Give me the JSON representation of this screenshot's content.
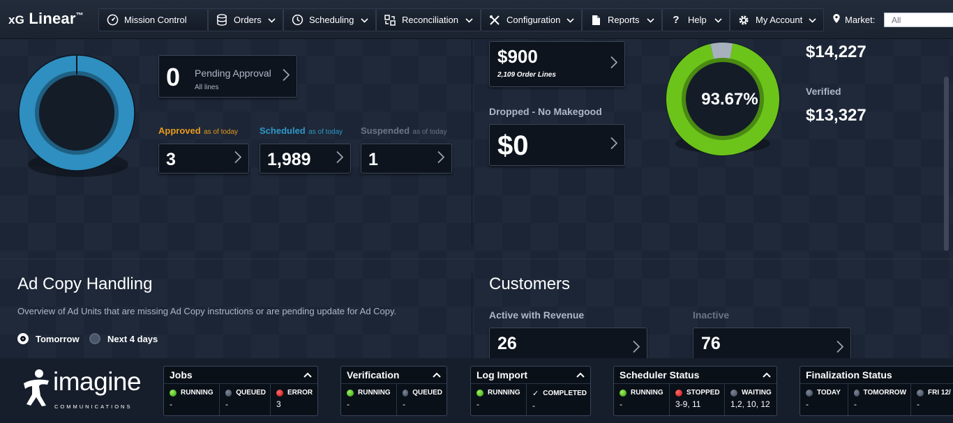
{
  "brand": {
    "prefix": "xG",
    "name": "Linear",
    "tm": "™"
  },
  "nav": [
    {
      "label": "Mission Control",
      "icon": "dashboard-icon"
    },
    {
      "label": "Orders",
      "icon": "database-icon"
    },
    {
      "label": "Scheduling",
      "icon": "clock-icon"
    },
    {
      "label": "Reconciliation",
      "icon": "reconcile-icon"
    },
    {
      "label": "Configuration",
      "icon": "tools-icon"
    },
    {
      "label": "Reports",
      "icon": "document-icon"
    },
    {
      "label": "Help",
      "icon": "question-icon"
    },
    {
      "label": "My Account",
      "icon": "gear-icon"
    }
  ],
  "market": {
    "label": "Market:",
    "value": "All"
  },
  "orders_panel": {
    "donut_colors": {
      "ring": "#2e8fc0",
      "inner": "#1f5f82"
    },
    "pending": {
      "value": "0",
      "label": "Pending Approval",
      "sub": "All lines"
    },
    "approved": {
      "label": "Approved",
      "asof": "as of today",
      "value": "3"
    },
    "scheduled": {
      "label": "Scheduled",
      "asof": "as of today",
      "value": "1,989"
    },
    "suspended": {
      "label": "Suspended",
      "asof": "as of today",
      "value": "1"
    }
  },
  "revenue_panel": {
    "order_lines_total": {
      "value": "$900",
      "sub": "2,109 Order Lines"
    },
    "dropped": {
      "label": "Dropped - No Makegood",
      "value": "$0"
    },
    "verified_pct": {
      "value": "93.67%",
      "fraction": 0.9367
    },
    "top_amount": "$14,227",
    "verified": {
      "label": "Verified",
      "value": "$13,327"
    },
    "colors": {
      "green": "#6cc41a",
      "gray": "#a7b1bd"
    }
  },
  "ad_copy": {
    "title": "Ad Copy Handling",
    "description": "Overview of Ad Units that are missing Ad Copy instructions or are pending update for Ad Copy.",
    "options": [
      {
        "label": "Tomorrow",
        "selected": true
      },
      {
        "label": "Next 4 days",
        "selected": false
      }
    ]
  },
  "customers": {
    "title": "Customers",
    "active": {
      "label": "Active with Revenue",
      "value": "26"
    },
    "inactive": {
      "label": "Inactive",
      "value": "76"
    }
  },
  "footer": {
    "logo": {
      "word": "imagine",
      "sub": "COMMUNICATIONS"
    },
    "jobs": {
      "title": "Jobs",
      "cols": [
        {
          "status": "RUNNING",
          "dot": "green",
          "value": "-"
        },
        {
          "status": "QUEUED",
          "dot": "gray",
          "value": "-"
        },
        {
          "status": "ERROR",
          "dot": "red",
          "value": "3"
        }
      ]
    },
    "verification": {
      "title": "Verification",
      "cols": [
        {
          "status": "RUNNING",
          "dot": "green",
          "value": "-"
        },
        {
          "status": "QUEUED",
          "dot": "gray",
          "value": "-"
        }
      ]
    },
    "log_import": {
      "title": "Log Import",
      "cols": [
        {
          "status": "RUNNING",
          "dot": "green",
          "value": "-"
        },
        {
          "status": "COMPLETED",
          "dot": "check",
          "value": "-"
        }
      ]
    },
    "scheduler": {
      "title": "Scheduler Status",
      "cols": [
        {
          "status": "RUNNING",
          "dot": "green",
          "value": "-"
        },
        {
          "status": "STOPPED",
          "dot": "red",
          "value": "3-9, 11"
        },
        {
          "status": "WAITING",
          "dot": "gray",
          "value": "1,2, 10, 12"
        }
      ]
    },
    "finalization": {
      "title": "Finalization Status",
      "cols": [
        {
          "status": "TODAY",
          "dot": "gray",
          "value": "-"
        },
        {
          "status": "TOMORROW",
          "dot": "gray",
          "value": "-"
        },
        {
          "status": "FRI 12/",
          "dot": "gray",
          "value": "-"
        }
      ]
    }
  }
}
